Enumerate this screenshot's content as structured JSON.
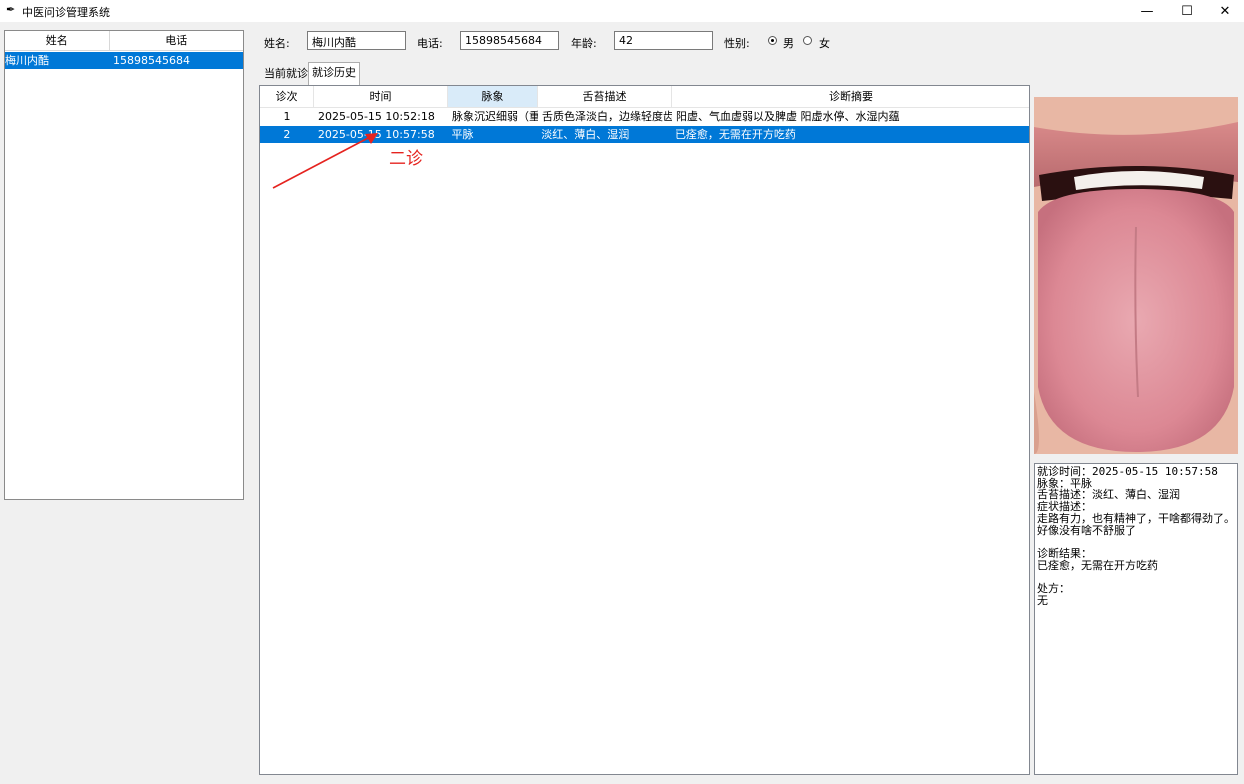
{
  "window": {
    "title": "中医问诊管理系统",
    "minimize_glyph": "—",
    "maximize_glyph": "☐",
    "close_glyph": "✕",
    "app_icon": "feather-icon"
  },
  "patient_list": {
    "columns": [
      "姓名",
      "电话"
    ],
    "rows": [
      {
        "name": "梅川内酷",
        "phone": "15898545684"
      }
    ]
  },
  "form": {
    "name_label": "姓名:",
    "name_value": "梅川内酷",
    "phone_label": "电话:",
    "phone_value": "15898545684",
    "age_label": "年龄:",
    "age_value": "42",
    "gender_label": "性别:",
    "gender_options": [
      "男",
      "女"
    ],
    "gender_selected": "男"
  },
  "tabs": [
    "当前就诊",
    "就诊历史"
  ],
  "active_tab": "就诊历史",
  "history": {
    "columns": [
      "诊次",
      "时间",
      "脉象",
      "舌苔描述",
      "诊断摘要"
    ],
    "rows": [
      {
        "no": "1",
        "time": "2025-05-15 10:52:18",
        "pulse": "脉象沉迟细弱（重",
        "tongue": "舌质色泽淡白，边缘轻度齿",
        "summary": "阳虚、气血虚弱以及脾虚  阳虚水停、水湿内蕴"
      },
      {
        "no": "2",
        "time": "2025-05-15 10:57:58",
        "pulse": "平脉",
        "tongue": "淡红、薄白、湿润",
        "summary": "已痊愈，无需在开方吃药"
      }
    ],
    "selected_row": 1
  },
  "annotation": {
    "text": "二诊",
    "color": "#e5231f"
  },
  "detail": {
    "image_label": "tongue-photo",
    "text": "就诊时间：2025-05-15 10:57:58\n脉象：平脉\n舌苔描述：淡红、薄白、湿润\n症状描述：\n走路有力，也有精神了，干啥都得劲了。好像没有啥不舒服了\n\n诊断结果：\n已痊愈，无需在开方吃药\n\n处方：\n无"
  },
  "colors": {
    "selection": "#0078d7",
    "accent_red": "#e5231f"
  }
}
